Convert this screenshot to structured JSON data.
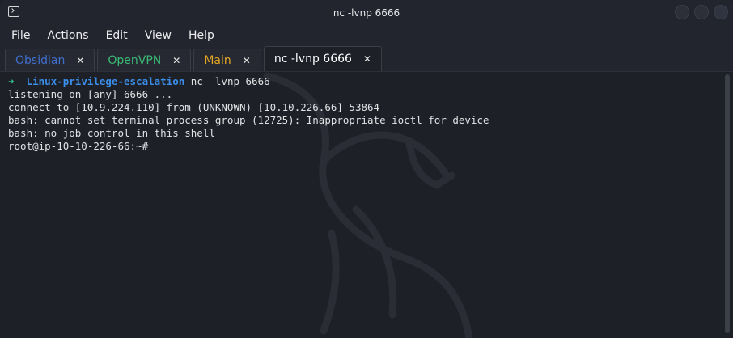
{
  "window": {
    "title": "nc -lvnp 6666"
  },
  "menu": [
    "File",
    "Actions",
    "Edit",
    "View",
    "Help"
  ],
  "tabs": [
    {
      "label": "Obsidian",
      "color": "#3f6fcf",
      "close": "✕",
      "active": false
    },
    {
      "label": "OpenVPN",
      "color": "#3bbb77",
      "close": "✕",
      "active": false
    },
    {
      "label": "Main",
      "color": "#e2a524",
      "close": "✕",
      "active": false
    },
    {
      "label": "nc -lvnp 6666",
      "color": "#ffffff",
      "close": "✕",
      "active": true
    }
  ],
  "terminal": {
    "prompt_arrow": "➜",
    "prompt_dir": "Linux-privilege-escalation",
    "command": "nc -lvnp 6666",
    "output": [
      "listening on [any] 6666 ...",
      "connect to [10.9.224.110] from (UNKNOWN) [10.10.226.66] 53864",
      "bash: cannot set terminal process group (12725): Inappropriate ioctl for device",
      "bash: no job control in this shell"
    ],
    "shell_prompt": "root@ip-10-10-226-66:~#"
  },
  "icons": {
    "app": "terminal-icon",
    "watermark": "kali-dragon-icon"
  }
}
